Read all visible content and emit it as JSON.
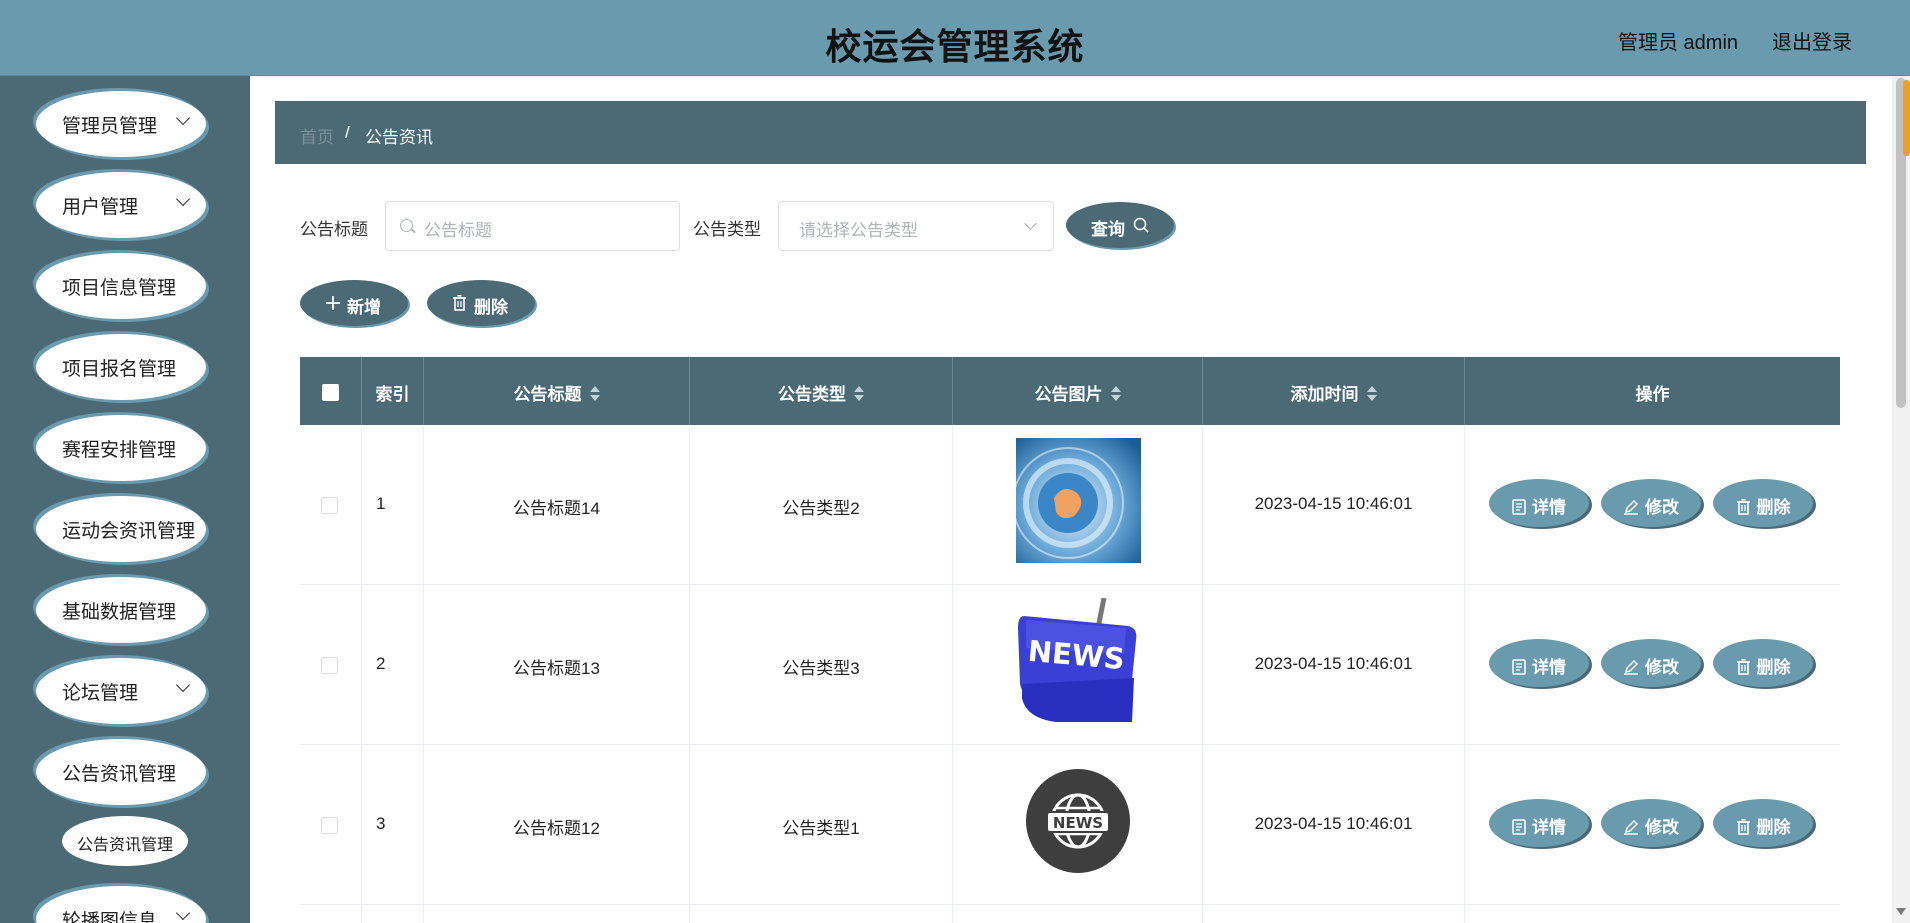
{
  "app": {
    "title": "校运会管理系统",
    "user_label": "管理员 admin",
    "logout_label": "退出登录"
  },
  "sidebar": {
    "items": [
      {
        "label": "管理员管理"
      },
      {
        "label": "用户管理"
      },
      {
        "label": "项目信息管理"
      },
      {
        "label": "项目报名管理"
      },
      {
        "label": "赛程安排管理"
      },
      {
        "label": "运动会资讯管理"
      },
      {
        "label": "基础数据管理"
      },
      {
        "label": "论坛管理"
      },
      {
        "label": "公告资讯管理"
      },
      {
        "label": "轮播图信息"
      }
    ],
    "sub_item": "公告资讯管理"
  },
  "breadcrumb": {
    "home": "首页",
    "separator": "/",
    "current": "公告资讯"
  },
  "search": {
    "title_label": "公告标题",
    "title_placeholder": "公告标题",
    "type_label": "公告类型",
    "type_placeholder": "请选择公告类型",
    "query_button": "查询"
  },
  "toolbar": {
    "add_label": "新增",
    "delete_label": "删除"
  },
  "table": {
    "columns": [
      "索引",
      "公告标题",
      "公告类型",
      "公告图片",
      "添加时间",
      "操作"
    ],
    "rows": [
      {
        "index": "1",
        "title": "公告标题14",
        "type": "公告类型2",
        "image": "news-globe-photo",
        "time": "2023-04-15 10:46:01"
      },
      {
        "index": "2",
        "title": "公告标题13",
        "type": "公告类型3",
        "image": "news-key-photo",
        "time": "2023-04-15 10:46:01"
      },
      {
        "index": "3",
        "title": "公告标题12",
        "type": "公告类型1",
        "image": "news-badge-icon",
        "time": "2023-04-15 10:46:01"
      }
    ],
    "actions": {
      "detail": "详情",
      "edit": "修改",
      "delete": "删除"
    }
  },
  "images": {
    "news_key_text": "NEWS",
    "news_badge_text": "NEWS"
  },
  "colors": {
    "header_bg": "#6a9aae",
    "sidebar_bg": "#4b6a76",
    "accent": "#4b6a76",
    "action_button": "#6a9aae"
  }
}
